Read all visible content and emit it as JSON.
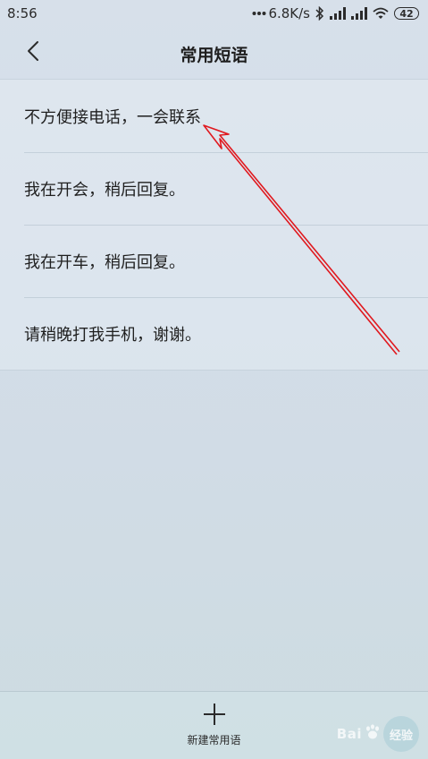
{
  "status_bar": {
    "time": "8:56",
    "network_speed": "6.8K/s",
    "battery": "42",
    "icons": [
      "dots-icon",
      "bluetooth-icon",
      "signal-icon",
      "signal-icon",
      "wifi-icon",
      "battery-icon"
    ]
  },
  "header": {
    "title": "常用短语",
    "back_icon": "chevron-left-icon"
  },
  "phrases": [
    "不方便接电话，一会联系",
    "我在开会，稍后回复。",
    "我在开车，稍后回复。",
    "请稍晚打我手机，谢谢。"
  ],
  "bottom_bar": {
    "new_phrase_label": "新建常用语",
    "icon": "plus-icon"
  },
  "watermark": {
    "text": "Bai",
    "badge": "经验"
  },
  "annotation": {
    "type": "arrow",
    "color": "#e0191f",
    "points_to": "phrases.0"
  }
}
